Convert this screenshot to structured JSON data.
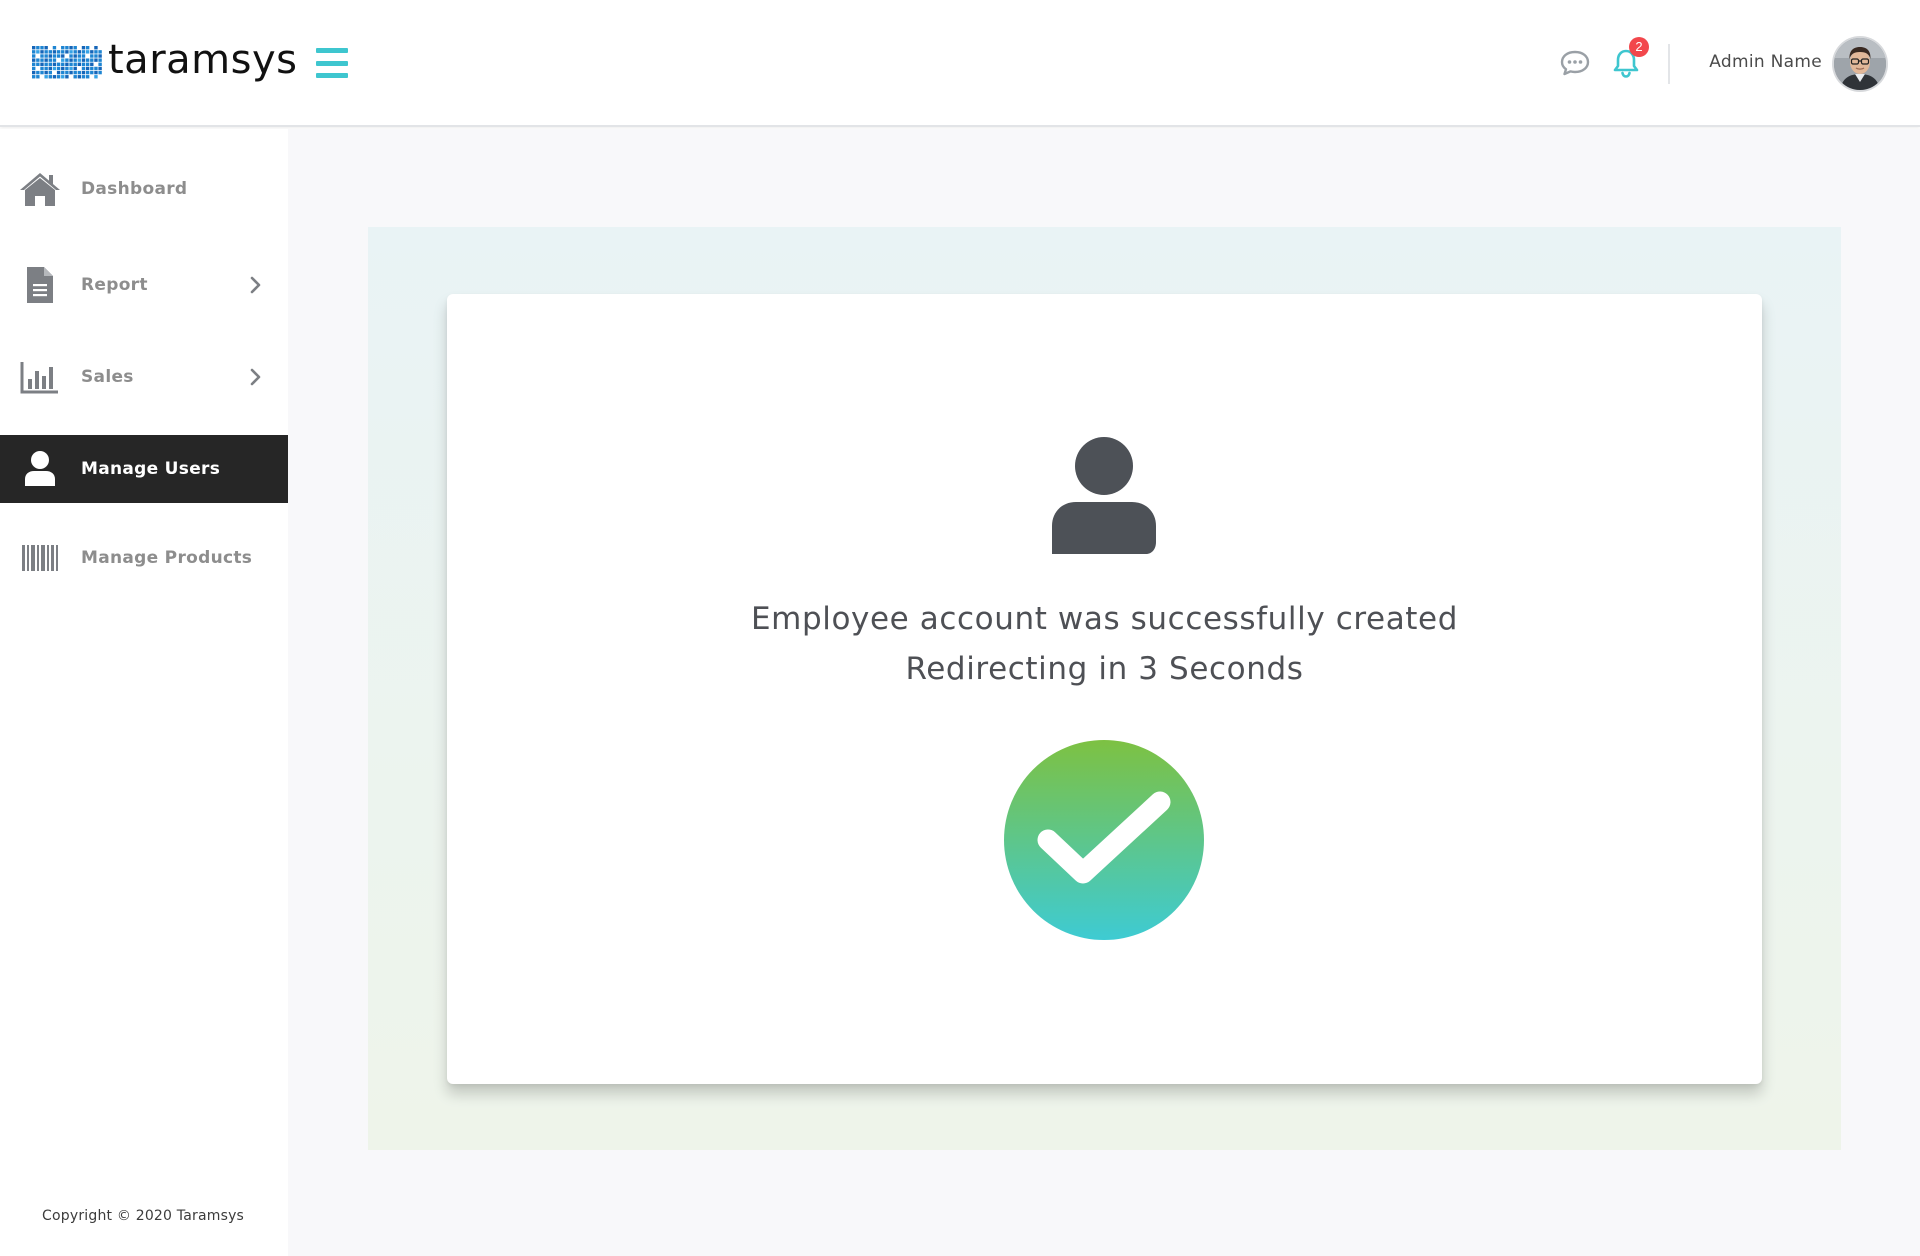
{
  "header": {
    "logo_text": "taramsys",
    "logo_icon": "pixel-grid-logo",
    "menu_icon": "hamburger-icon",
    "chat_icon": "chat-bubble-icon",
    "notification_icon": "bell-icon",
    "notification_count": "2",
    "user_name": "Admin Name",
    "avatar_icon": "user-photo-avatar"
  },
  "sidebar": {
    "items": [
      {
        "label": "Dashboard",
        "icon": "home-icon",
        "has_submenu": false,
        "active": false
      },
      {
        "label": "Report",
        "icon": "document-icon",
        "has_submenu": true,
        "active": false
      },
      {
        "label": "Sales",
        "icon": "bar-chart-icon",
        "has_submenu": true,
        "active": false
      },
      {
        "label": "Manage Users",
        "icon": "user-icon",
        "has_submenu": false,
        "active": true
      },
      {
        "label": "Manage Products",
        "icon": "barcode-icon",
        "has_submenu": false,
        "active": false
      }
    ],
    "copyright": "Copyright © 2020 Taramsys"
  },
  "main": {
    "card": {
      "icon": "user-icon",
      "message": "Employee account was successfully created",
      "redirect_text": "Redirecting in 3 Seconds",
      "status_icon": "success-check-icon"
    }
  },
  "colors": {
    "accent": "#3ec6cf",
    "badge": "#f2474c",
    "active_nav_bg": "#262626",
    "check_gradient_top": "#7dc142",
    "check_gradient_bottom": "#3ecbd3",
    "icon_dark": "#4d5157"
  }
}
